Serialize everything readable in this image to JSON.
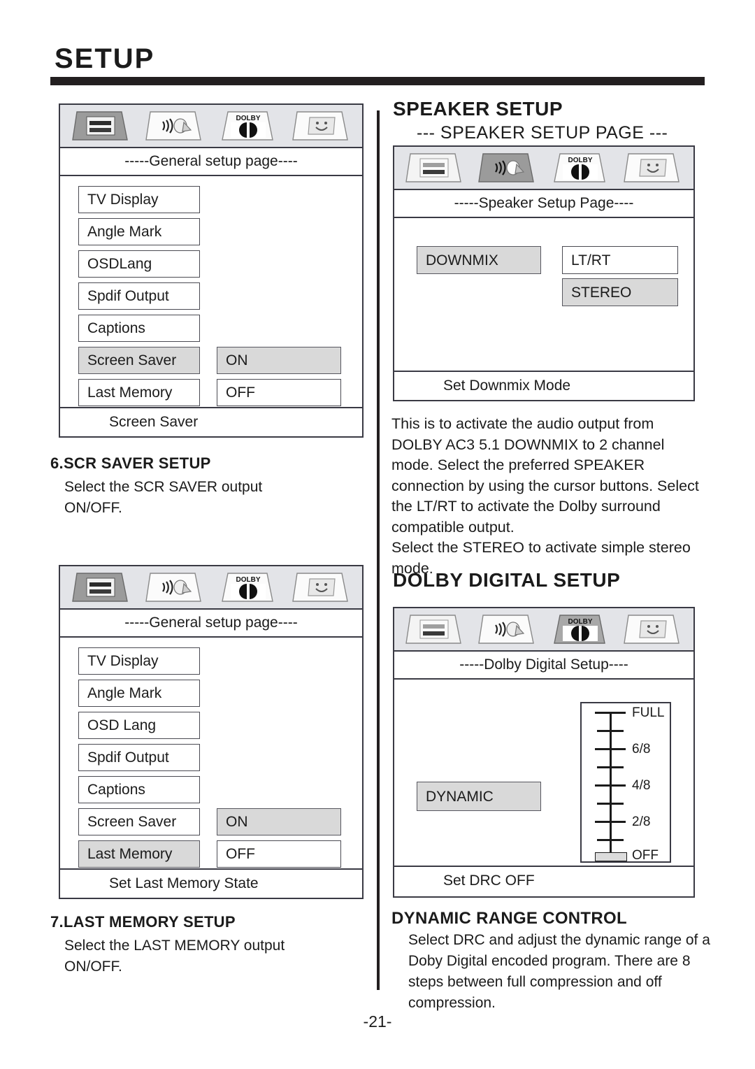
{
  "document": {
    "title": "SETUP",
    "page_number": "-21-"
  },
  "panel_general_1": {
    "subtitle": "-----General setup page----",
    "tabs": [
      "general-setup-icon",
      "speaker-setup-icon",
      "dolby-digital-icon",
      "preference-setup-icon"
    ],
    "active_tab": "general-setup-icon",
    "menu_items": [
      {
        "label": "TV Display",
        "highlighted": false
      },
      {
        "label": "Angle Mark",
        "highlighted": false
      },
      {
        "label": "OSDLang",
        "highlighted": false
      },
      {
        "label": "Spdif Output",
        "highlighted": false
      },
      {
        "label": "Captions",
        "highlighted": false
      },
      {
        "label": "Screen Saver",
        "highlighted": true
      },
      {
        "label": "Last Memory",
        "highlighted": false
      }
    ],
    "options": [
      {
        "label": "ON",
        "highlighted": true
      },
      {
        "label": "OFF",
        "highlighted": false
      }
    ],
    "footer": "Screen Saver"
  },
  "section_scr_saver": {
    "heading": "6.SCR SAVER SETUP",
    "body": "Select the SCR SAVER output\nON/OFF."
  },
  "panel_general_2": {
    "subtitle": "-----General setup page----",
    "tabs": [
      "general-setup-icon",
      "speaker-setup-icon",
      "dolby-digital-icon",
      "preference-setup-icon"
    ],
    "active_tab": "general-setup-icon",
    "menu_items": [
      {
        "label": "TV Display",
        "highlighted": false
      },
      {
        "label": "Angle Mark",
        "highlighted": false
      },
      {
        "label": "OSD Lang",
        "highlighted": false
      },
      {
        "label": "Spdif Output",
        "highlighted": false
      },
      {
        "label": "Captions",
        "highlighted": false
      },
      {
        "label": "Screen Saver",
        "highlighted": false
      },
      {
        "label": "Last Memory",
        "highlighted": true
      }
    ],
    "options": [
      {
        "label": "ON",
        "highlighted": true
      },
      {
        "label": "OFF",
        "highlighted": false
      }
    ],
    "footer": "Set Last Memory State"
  },
  "section_last_memory": {
    "heading": "7.LAST MEMORY SETUP",
    "body": "Select the LAST MEMORY output\nON/OFF."
  },
  "speaker_setup": {
    "heading": "SPEAKER SETUP",
    "page_label": "--- SPEAKER SETUP PAGE ---",
    "panel": {
      "subtitle": "-----Speaker Setup Page----",
      "tabs": [
        "general-setup-icon",
        "speaker-setup-icon",
        "dolby-digital-icon",
        "preference-setup-icon"
      ],
      "active_tab": "speaker-setup-icon",
      "menu_items": [
        {
          "label": "DOWNMIX",
          "highlighted": true
        }
      ],
      "options": [
        {
          "label": "LT/RT",
          "highlighted": false
        },
        {
          "label": "STEREO",
          "highlighted": true
        }
      ],
      "footer": "Set Downmix Mode"
    },
    "body": "This is to activate the audio output from DOLBY AC3 5.1 DOWNMIX to 2 channel mode.  Select the preferred SPEAKER connection by using the cursor buttons. Select the LT/RT to activate the Dolby surround compatible output.\nSelect the STEREO to activate simple stereo mode."
  },
  "dolby_digital_setup": {
    "heading": "DOLBY DIGITAL SETUP",
    "panel": {
      "subtitle": "-----Dolby Digital Setup----",
      "tabs": [
        "general-setup-icon",
        "speaker-setup-icon",
        "dolby-digital-icon",
        "preference-setup-icon"
      ],
      "active_tab": "dolby-digital-icon",
      "menu_items": [
        {
          "label": "DYNAMIC",
          "highlighted": true
        }
      ],
      "footer": "Set DRC OFF"
    },
    "drc_slider": {
      "labels": [
        "FULL",
        "6/8",
        "4/8",
        "2/8",
        "OFF"
      ],
      "tick_count": 9,
      "current_value": "OFF",
      "knob_position_index": 8
    },
    "section": {
      "heading": "DYNAMIC RANGE CONTROL",
      "body": "Select DRC and adjust the dynamic range of a Doby Digital encoded program.  There are 8 steps between full compression and off compression."
    }
  }
}
